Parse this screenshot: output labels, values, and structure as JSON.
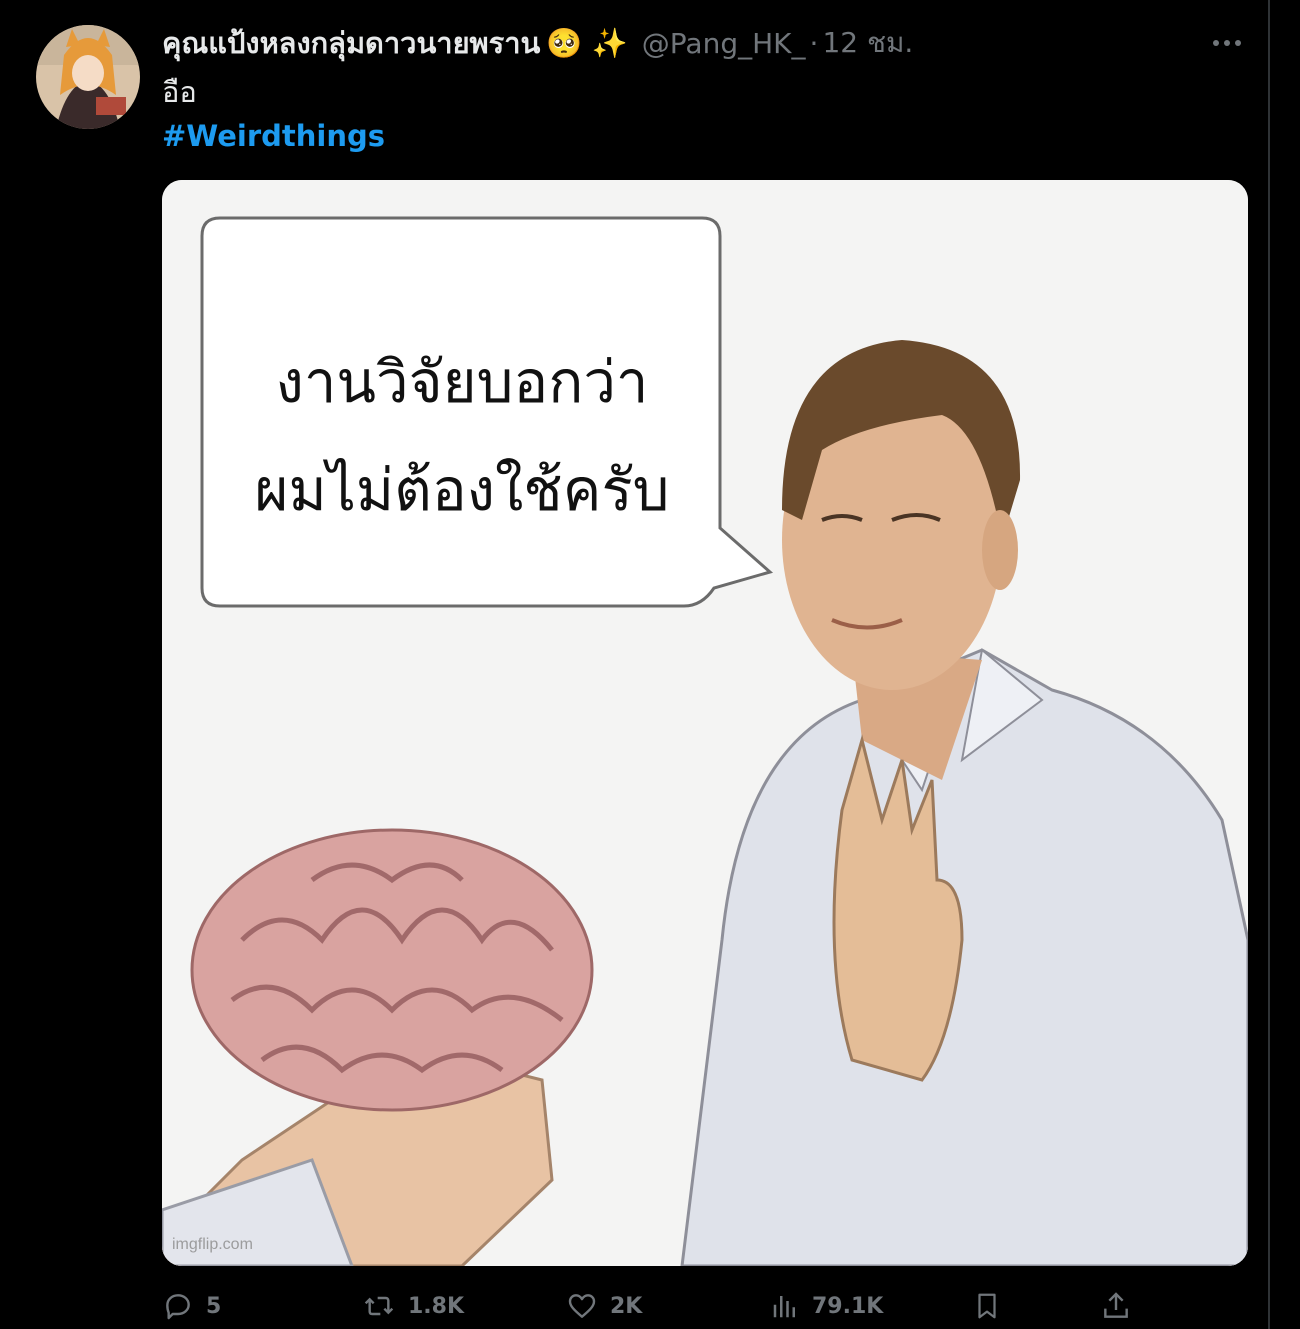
{
  "post": {
    "display_name": "คุณแป้งหลงกลุ่มดาวนายพราน",
    "name_emojis": "🥺 ✨",
    "handle": "@Pang_HK_",
    "separator": "·",
    "time": "12 ชม.",
    "text": "อือ",
    "hashtag": "#Weirdthings"
  },
  "media": {
    "speech_line1": "งานวิจัยบอกว่า",
    "speech_line2": "ผมไม่ต้องใช้ครับ",
    "watermark": "imgflip.com"
  },
  "actions": {
    "replies": "5",
    "reposts": "1.8K",
    "likes": "2K",
    "views": "79.1K"
  },
  "colors": {
    "background": "#000000",
    "text": "#e7e9ea",
    "muted": "#71767b",
    "link": "#1d9bf0"
  }
}
